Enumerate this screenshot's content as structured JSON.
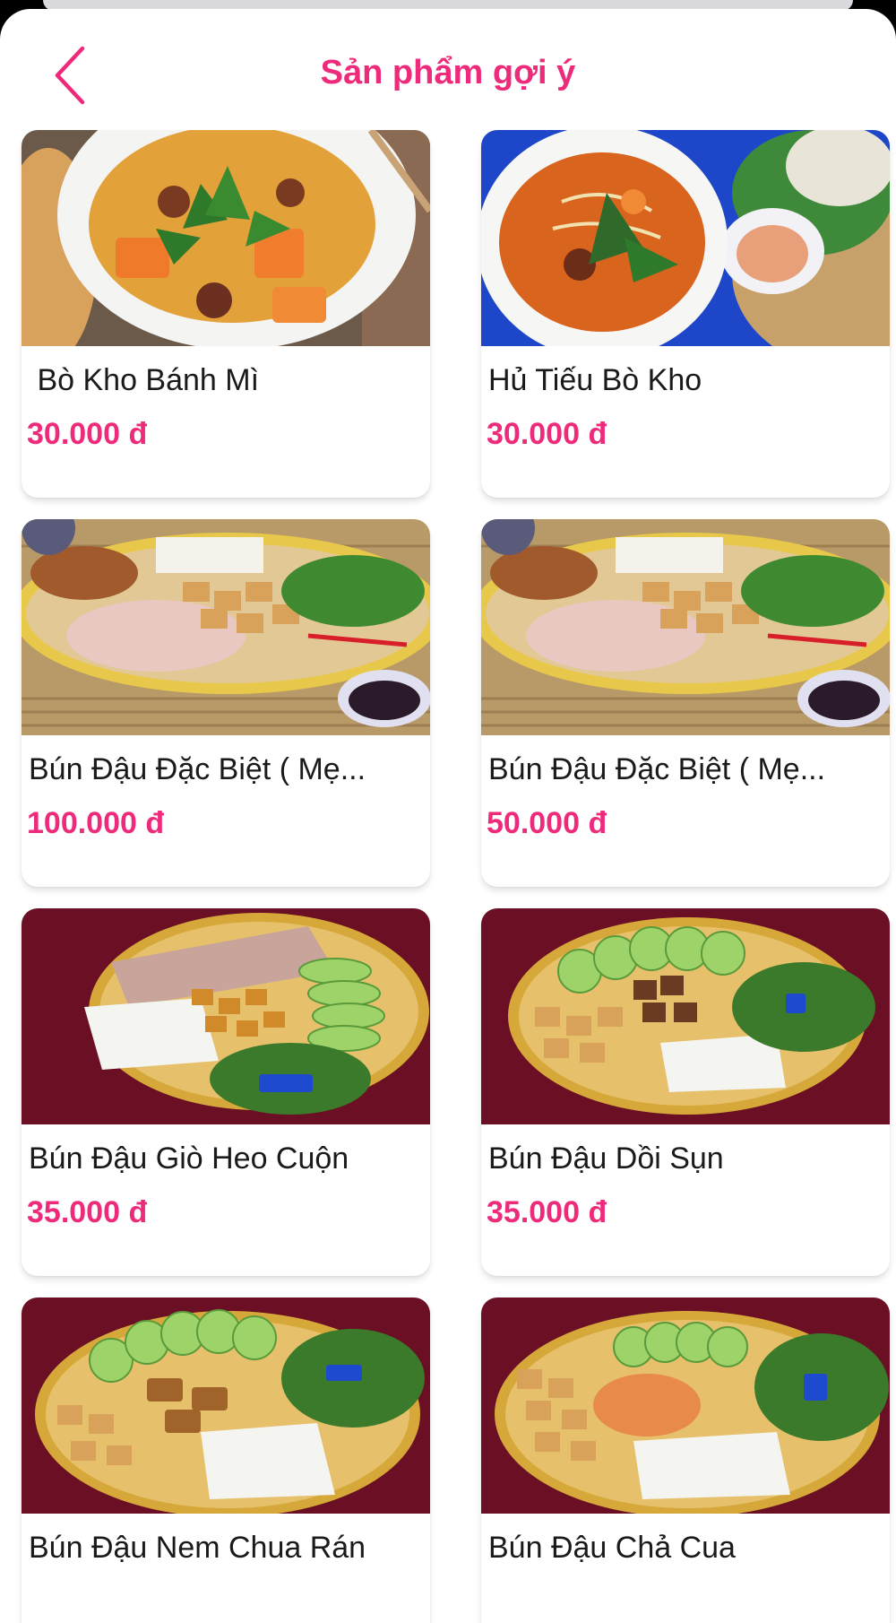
{
  "header": {
    "title": "Sản phẩm gợi ý"
  },
  "products": [
    {
      "name": " Bò Kho Bánh Mì",
      "price": "30.000 đ",
      "image": "bo-kho-banh-mi"
    },
    {
      "name": "Hủ Tiếu Bò Kho",
      "price": "30.000 đ",
      "image": "hu-tieu-bo-kho"
    },
    {
      "name": "Bún Đậu Đặc Biệt ( Mẹ...",
      "price": "100.000 đ",
      "image": "bun-dau-dac-biet"
    },
    {
      "name": "Bún Đậu Đặc Biệt ( Mẹ...",
      "price": "50.000 đ",
      "image": "bun-dau-dac-biet"
    },
    {
      "name": "Bún Đậu Giò Heo Cuộn",
      "price": "35.000 đ",
      "image": "bun-dau-gio-heo"
    },
    {
      "name": "Bún Đậu Dồi Sụn",
      "price": "35.000 đ",
      "image": "bun-dau-doi-sun"
    },
    {
      "name": "Bún Đậu Nem Chua Rán",
      "price": "",
      "image": "bun-dau-nem-chua"
    },
    {
      "name": "Bún Đậu Chả Cua",
      "price": "",
      "image": "bun-dau-cha-cua"
    }
  ],
  "colors": {
    "accent": "#ee2a7b",
    "text": "#1a1a1a",
    "background": "#ffffff"
  },
  "icons": {
    "back": "chevron-left-icon"
  }
}
